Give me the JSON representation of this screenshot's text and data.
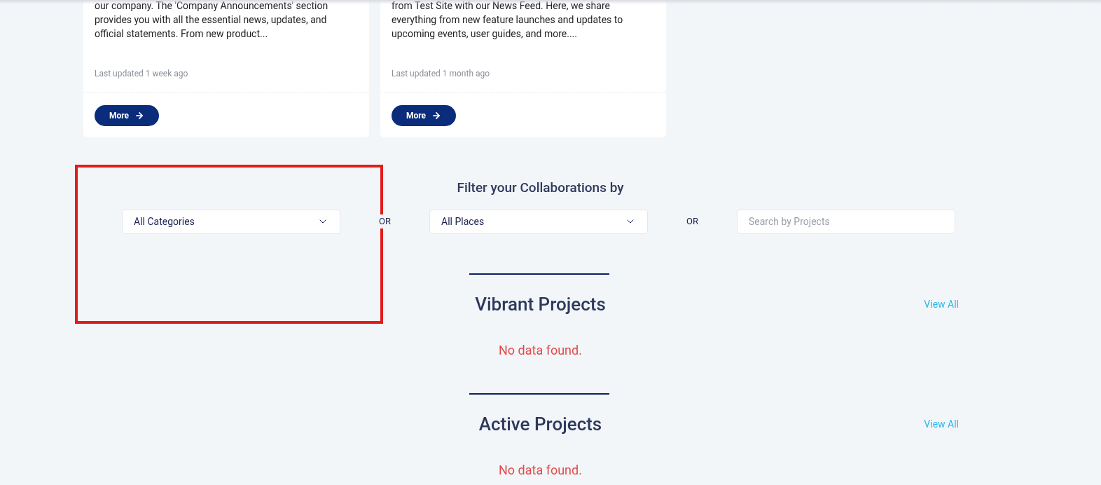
{
  "cards": [
    {
      "text": "our company. The 'Company Announcements' section provides you with all the essential news, updates, and official statements. From new product...",
      "updated": "Last updated 1 week ago",
      "button": "More"
    },
    {
      "text": "from Test Site with our News Feed. Here, we share everything from new feature launches and updates to upcoming events, user guides, and more....",
      "updated": "Last updated 1 month ago",
      "button": "More"
    }
  ],
  "filter": {
    "title": "Filter your Collaborations by",
    "category_select": "All Categories",
    "separator_1": "OR",
    "place_select": "All Places",
    "separator_2": "OR",
    "search": {
      "placeholder": "Search by Projects"
    }
  },
  "sections": [
    {
      "title": "Vibrant Projects",
      "link": "View All",
      "message": "No data found."
    },
    {
      "title": "Active Projects",
      "link": "View All",
      "message": "No data found."
    }
  ]
}
